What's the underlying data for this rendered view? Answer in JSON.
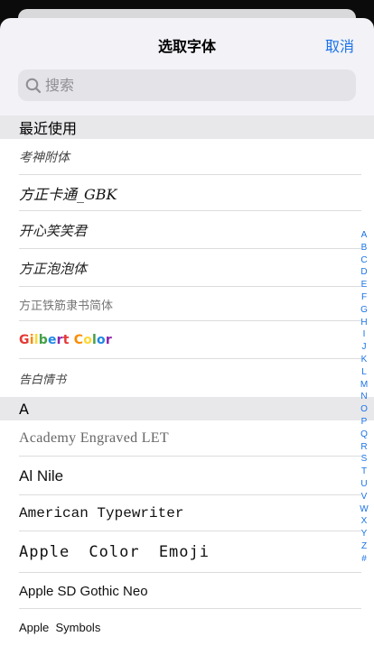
{
  "header": {
    "title": "选取字体",
    "cancel_label": "取消"
  },
  "search": {
    "placeholder": "搜索"
  },
  "recent": {
    "header": "最近使用",
    "items": [
      "考神附体",
      "方正卡通_GBK",
      "开心笑笑君",
      "方正泡泡体",
      "方正铁筋隶书简体",
      "Gilbert Color",
      "告白情书"
    ]
  },
  "gilbert_colors": [
    "#e53935",
    "#fb8c00",
    "#fdd835",
    "#43a047",
    "#1e88e5",
    "#8e24aa"
  ],
  "section_a": {
    "header": "A",
    "items": [
      "Academy Engraved LET",
      "Al Nile",
      "American Typewriter",
      "Apple  Color  Emoji",
      "Apple SD Gothic Neo",
      "Apple  Symbols"
    ]
  },
  "index_letters": [
    "A",
    "B",
    "C",
    "D",
    "E",
    "F",
    "G",
    "H",
    "I",
    "J",
    "K",
    "L",
    "M",
    "N",
    "O",
    "P",
    "Q",
    "R",
    "S",
    "T",
    "U",
    "V",
    "W",
    "X",
    "Y",
    "Z",
    "#"
  ],
  "colors": {
    "accent": "#1a73e8"
  }
}
